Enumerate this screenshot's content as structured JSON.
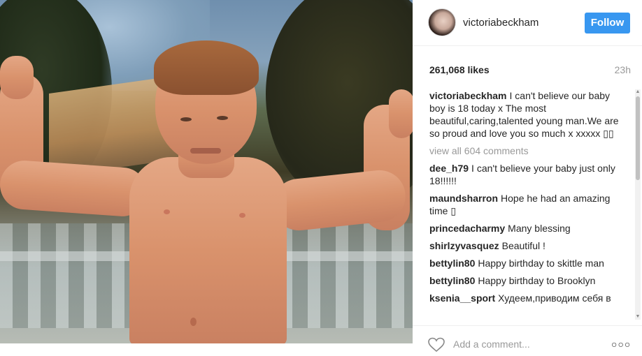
{
  "post": {
    "username": "victoriabeckham",
    "follow_label": "Follow",
    "likes": "261,068 likes",
    "time": "23h",
    "view_all": "view all 604 comments",
    "add_comment_placeholder": "Add a comment...",
    "more_label": "○○○"
  },
  "caption": {
    "username": "victoriabeckham",
    "text": "I can't believe our baby boy is 18 today x The most beautiful,caring,talented young man.We are so proud and love you so much x xxxxx ▯▯"
  },
  "comments": [
    {
      "username": "dee_h79",
      "text": "I can't believe your baby just only 18!!!!!!"
    },
    {
      "username": "maundsharron",
      "text": "Hope he had an amazing time ▯"
    },
    {
      "username": "princedacharmy",
      "text": "Many blessing"
    },
    {
      "username": "shirlzyvasquez",
      "text": "Beautiful !"
    },
    {
      "username": "bettylin80",
      "text": "Happy birthday to skittle man"
    },
    {
      "username": "bettylin80",
      "text": "Happy birthday to Brooklyn"
    },
    {
      "username": "ksenia__sport",
      "text": "Худеем,приводим себя в"
    }
  ],
  "colors": {
    "follow_bg": "#3897f0",
    "muted_text": "#999999",
    "text": "#262626"
  },
  "icons": {
    "heart": "heart-icon",
    "more": "more-options-icon",
    "avatar": "avatar"
  }
}
